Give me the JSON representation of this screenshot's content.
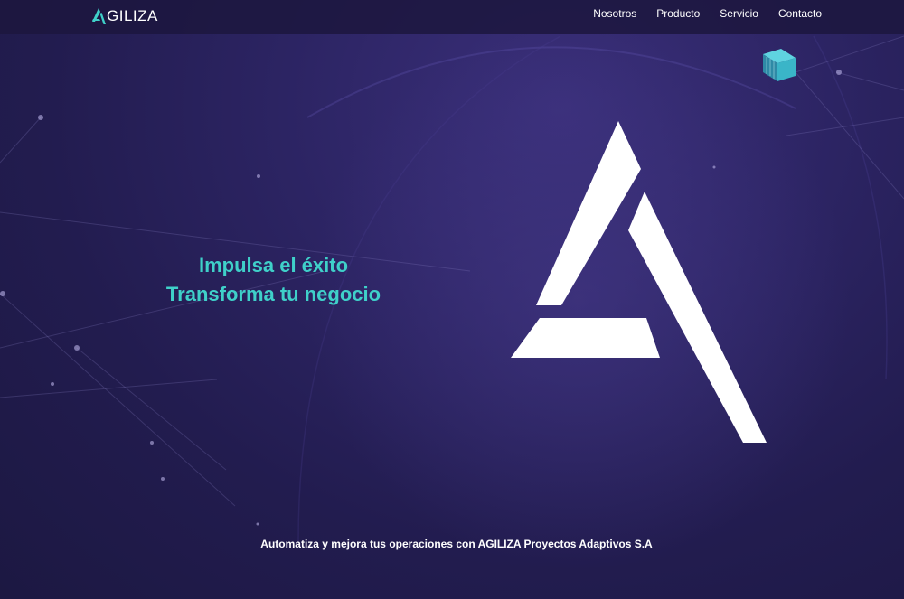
{
  "header": {
    "logo_text": "GILIZA",
    "nav": [
      {
        "label": "Nosotros"
      },
      {
        "label": "Producto"
      },
      {
        "label": "Servicio"
      },
      {
        "label": "Contacto"
      }
    ]
  },
  "hero": {
    "line1": "Impulsa el éxito",
    "line2": "Transforma tu negocio"
  },
  "tagline": "Automatiza y mejora tus operaciones con AGILIZA Proyectos Adaptivos S.A",
  "colors": {
    "accent": "#3fd0c9",
    "background": "#2a2360",
    "text": "#ffffff"
  },
  "icons": {
    "logo": "agiliza-a-mark-icon",
    "hero_graphic": "agiliza-a-logo-icon",
    "decoration": "cube-icon"
  }
}
